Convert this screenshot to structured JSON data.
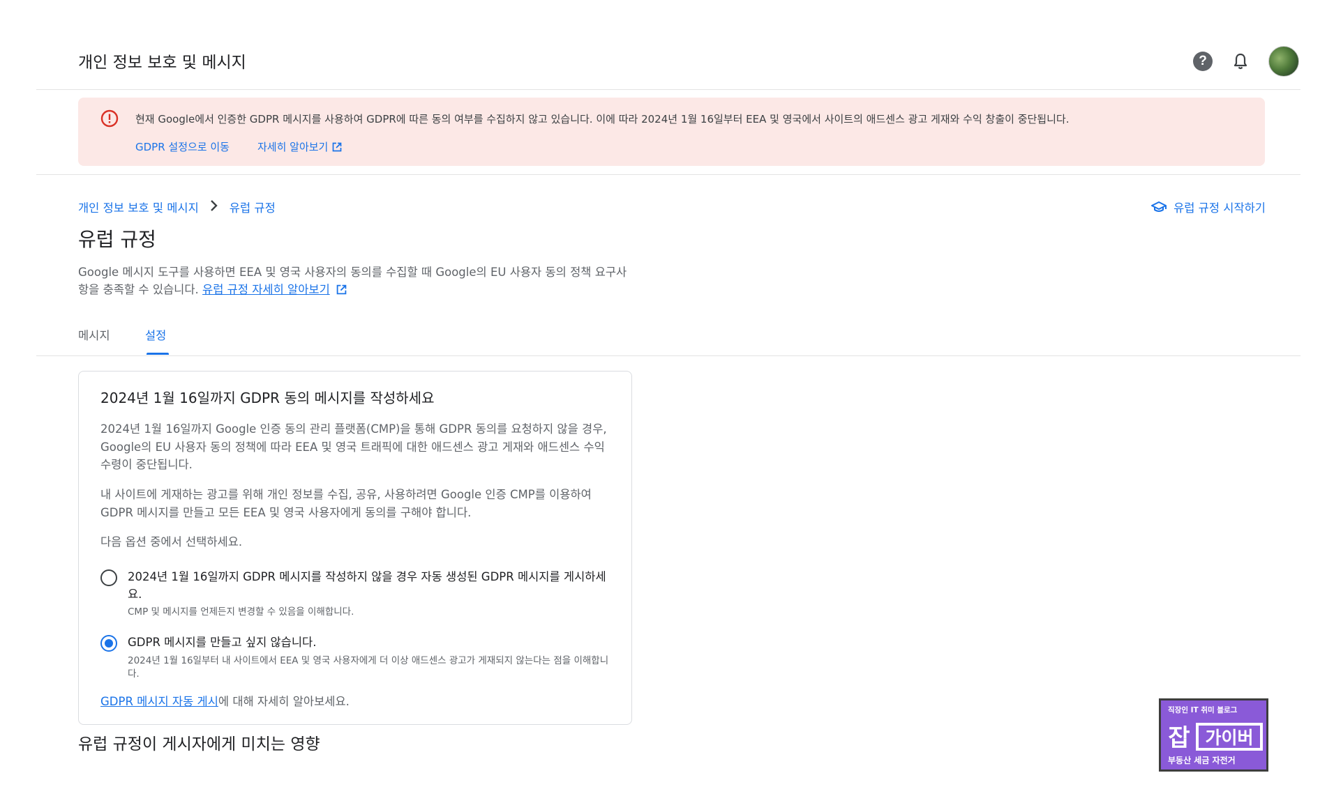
{
  "header": {
    "title": "개인 정보 보호 및 메시지"
  },
  "banner": {
    "message": "현재 Google에서 인증한 GDPR 메시지를 사용하여 GDPR에 따른 동의 여부를 수집하지 않고 있습니다. 이에 따라 2024년 1월 16일부터 EEA 및 영국에서 사이트의 애드센스 광고 게재와 수익 창출이 중단됩니다.",
    "link_settings": "GDPR 설정으로 이동",
    "link_learn_more": "자세히 알아보기"
  },
  "breadcrumb": {
    "parent": "개인 정보 보호 및 메시지",
    "current": "유럽 규정"
  },
  "start_link": "유럽 규정 시작하기",
  "page": {
    "title": "유럽 규정",
    "description": "Google 메시지 도구를 사용하면 EEA 및 영국 사용자의 동의를 수집할 때 Google의 EU 사용자 동의 정책 요구사항을 충족할 수 있습니다.",
    "description_link": "유럽 규정 자세히 알아보기"
  },
  "tabs": [
    {
      "label": "메시지",
      "active": false
    },
    {
      "label": "설정",
      "active": true
    }
  ],
  "card": {
    "title": "2024년 1월 16일까지 GDPR 동의 메시지를 작성하세요",
    "p1": "2024년 1월 16일까지 Google 인증 동의 관리 플랫폼(CMP)을 통해 GDPR 동의를 요청하지 않을 경우, Google의 EU 사용자 동의 정책에 따라 EEA 및 영국 트래픽에 대한 애드센스 광고 게재와 애드센스 수익 수령이 중단됩니다.",
    "p2": "내 사이트에 게재하는 광고를 위해 개인 정보를 수집, 공유, 사용하려면 Google 인증 CMP를 이용하여 GDPR 메시지를 만들고 모든 EEA 및 영국 사용자에게 동의를 구해야 합니다.",
    "p3": "다음 옵션 중에서 선택하세요.",
    "options": [
      {
        "label": "2024년 1월 16일까지 GDPR 메시지를 작성하지 않을 경우 자동 생성된 GDPR 메시지를 게시하세요.",
        "sub": "CMP 및 메시지를 언제든지 변경할 수 있음을 이해합니다.",
        "selected": false
      },
      {
        "label": "GDPR 메시지를 만들고 싶지 않습니다.",
        "sub": "2024년 1월 16일부터 내 사이트에서 EEA 및 영국 사용자에게 더 이상 애드센스 광고가 게재되지 않는다는 점을 이해합니다.",
        "selected": true
      }
    ],
    "footer_link": "GDPR 메시지 자동 게시",
    "footer_text": "에 대해 자세히 알아보세요."
  },
  "section_title": "유럽 규정이 게시자에게 미치는 영향",
  "watermark": {
    "top": "직장인 IT 취미 블로그",
    "main": "잡가이버",
    "bottom": "부동산 세금 자전거"
  },
  "colors": {
    "accent": "#1a73e8",
    "banner_bg": "#fce8e6",
    "error": "#d93025",
    "logo_bg": "#8a5ad8"
  },
  "icons": [
    "help-icon",
    "bell-icon",
    "avatar",
    "error-icon",
    "open-in-new-icon",
    "chevron-right-icon",
    "school-icon"
  ]
}
